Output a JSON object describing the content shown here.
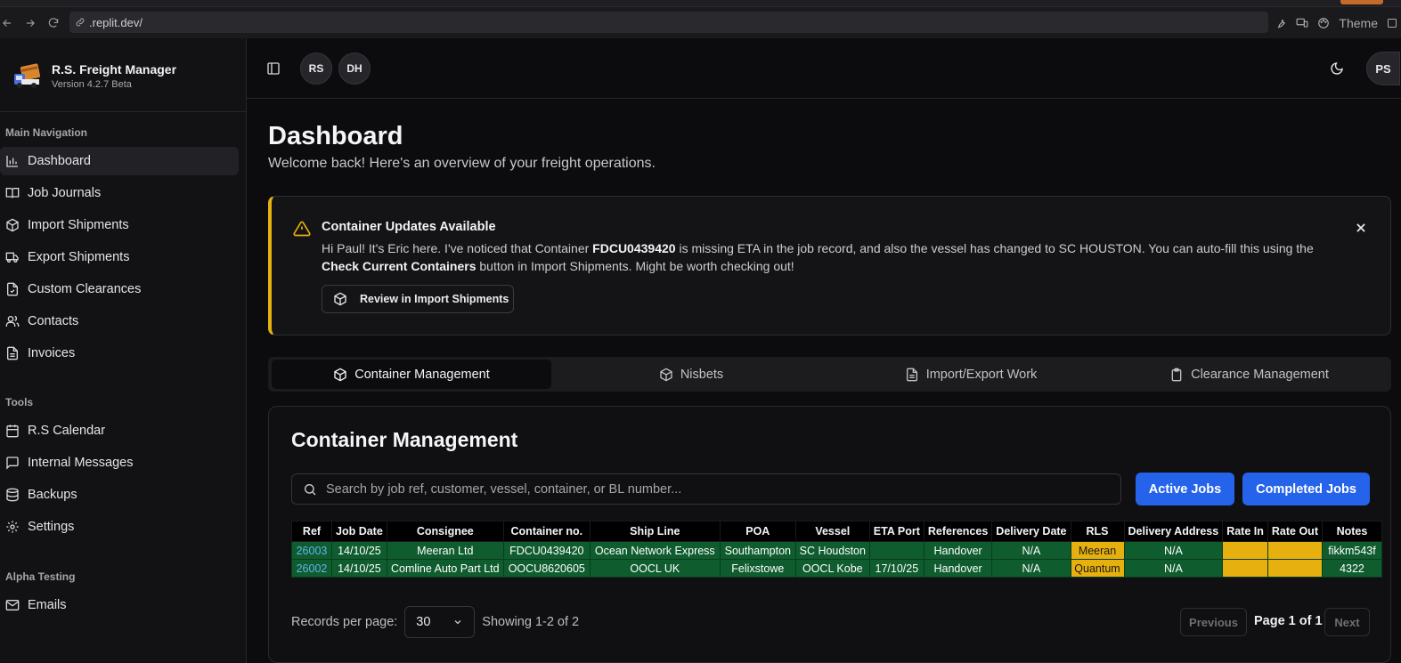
{
  "browser": {
    "url": ".replit.dev/",
    "theme_label": "Theme"
  },
  "sidebar": {
    "app_name": "R.S. Freight Manager",
    "version": "Version 4.2.7 Beta",
    "main_nav_label": "Main Navigation",
    "main_nav": [
      {
        "label": "Dashboard",
        "icon": "bar-chart-icon",
        "active": true
      },
      {
        "label": "Job Journals",
        "icon": "book-open-icon"
      },
      {
        "label": "Import Shipments",
        "icon": "package-icon"
      },
      {
        "label": "Export Shipments",
        "icon": "truck-icon"
      },
      {
        "label": "Custom Clearances",
        "icon": "file-check-icon"
      },
      {
        "label": "Contacts",
        "icon": "users-icon"
      },
      {
        "label": "Invoices",
        "icon": "file-text-icon"
      }
    ],
    "tools_label": "Tools",
    "tools": [
      {
        "label": "R.S Calendar",
        "icon": "calendar-icon"
      },
      {
        "label": "Internal Messages",
        "icon": "message-square-icon"
      },
      {
        "label": "Backups",
        "icon": "database-icon"
      },
      {
        "label": "Settings",
        "icon": "gear-icon"
      }
    ],
    "alpha_label": "Alpha Testing",
    "alpha": [
      {
        "label": "Emails",
        "icon": "mail-icon"
      }
    ]
  },
  "topbar": {
    "user_avatars": [
      "RS",
      "DH"
    ],
    "profile_avatar": "PS"
  },
  "page": {
    "title": "Dashboard",
    "subtitle": "Welcome back! Here's an overview of your freight operations."
  },
  "alert": {
    "title": "Container Updates Available",
    "text_1": "Hi Paul! It's Eric here. I've noticed that Container ",
    "container": "FDCU0439420",
    "text_2": " is missing ETA in the job record, and also the vessel has changed to SC HOUSTON. You can auto-fill this using the ",
    "button_ref": "Check Current Containers",
    "text_3": " button in Import Shipments. Might be worth checking out!",
    "action_label": "Review in Import Shipments"
  },
  "tabs": [
    {
      "label": "Container Management",
      "icon": "package-icon",
      "active": true
    },
    {
      "label": "Nisbets",
      "icon": "box-icon"
    },
    {
      "label": "Import/Export Work",
      "icon": "file-text-icon"
    },
    {
      "label": "Clearance Management",
      "icon": "clipboard-icon"
    }
  ],
  "container_management": {
    "title": "Container Management",
    "search_placeholder": "Search by job ref, customer, vessel, container, or BL number...",
    "active_jobs_label": "Active Jobs",
    "completed_jobs_label": "Completed Jobs",
    "columns": [
      "Ref",
      "Job Date",
      "Consignee",
      "Container no.",
      "Ship Line",
      "POA",
      "Vessel",
      "ETA Port",
      "References",
      "Delivery Date",
      "RLS",
      "Delivery Address",
      "Rate In",
      "Rate Out",
      "Notes"
    ],
    "rows": [
      [
        "26003",
        "14/10/25",
        "Meeran Ltd",
        "FDCU0439420",
        "Ocean Network Express",
        "Southampton",
        "SC Houdston",
        "",
        "Handover",
        "N/A",
        "Meeran",
        "N/A",
        "",
        "",
        "fikkm543f"
      ],
      [
        "26002",
        "14/10/25",
        "Comline Auto Part Ltd",
        "OOCU8620605",
        "OOCL UK",
        "Felixstowe",
        "OOCL Kobe",
        "17/10/25",
        "Handover",
        "N/A",
        "Quantum",
        "N/A",
        "",
        "",
        "4322"
      ]
    ],
    "records_per_page_label": "Records per page:",
    "records_per_page": "30",
    "showing": "Showing 1-2 of 2",
    "prev_label": "Previous",
    "page_label": "Page 1 of 1",
    "next_label": "Next"
  },
  "colors": {
    "accent_blue": "#2563eb",
    "warning_yellow": "#e6b00f",
    "row_green": "#0f5c2e"
  }
}
